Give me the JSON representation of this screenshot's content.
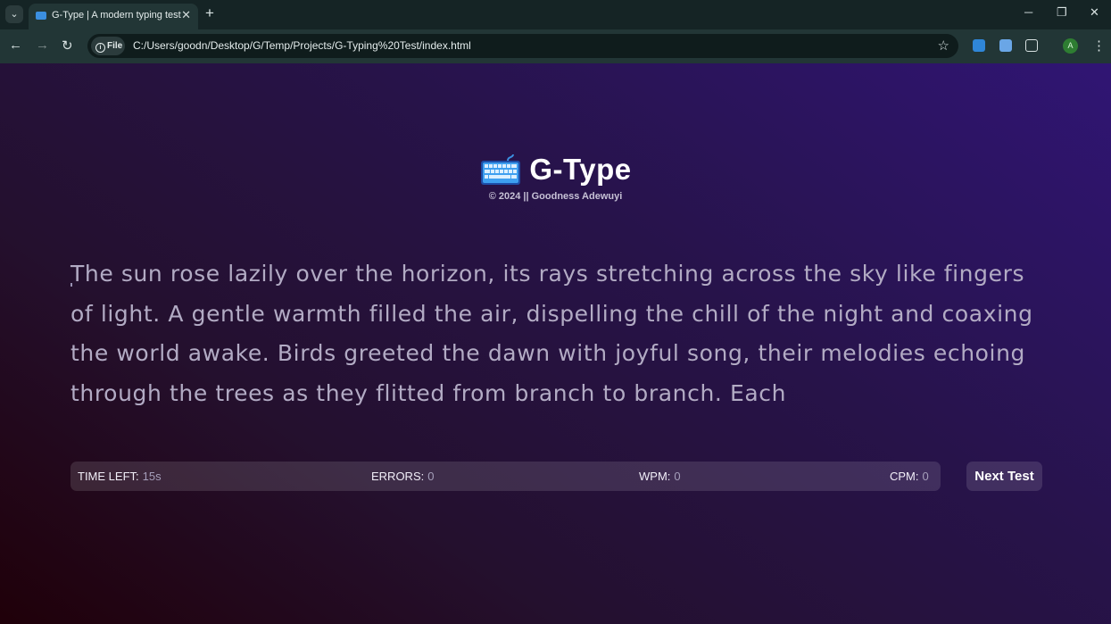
{
  "browser": {
    "tab_title": "G-Type | A modern typing test",
    "site_chip_label": "File",
    "url": "C:/Users/goodn/Desktop/G/Temp/Projects/G-Typing%20Test/index.html",
    "profile_initial": "A"
  },
  "header": {
    "title": "G-Type",
    "subtitle": "© 2024 || Goodness Adewuyi",
    "icon": "keyboard-icon"
  },
  "passage": {
    "text": "The sun rose lazily over the horizon, its rays stretching across the sky like fingers of light. A gentle warmth filled the air, dispelling the chill of the night and coaxing the world awake. Birds greeted the dawn with joyful song, their melodies echoing through the trees as they flitted from branch to branch. Each"
  },
  "stats": {
    "time_left_label": "TIME LEFT:",
    "time_left_value": "15s",
    "errors_label": "ERRORS:",
    "errors_value": "0",
    "wpm_label": "WPM:",
    "wpm_value": "0",
    "cpm_label": "CPM:",
    "cpm_value": "0"
  },
  "actions": {
    "next_test_label": "Next Test"
  },
  "colors": {
    "bg_start": "#200009",
    "bg_end": "#301574",
    "passage_text": "#b2abc4",
    "icon_blue": "#3b8fe0"
  }
}
